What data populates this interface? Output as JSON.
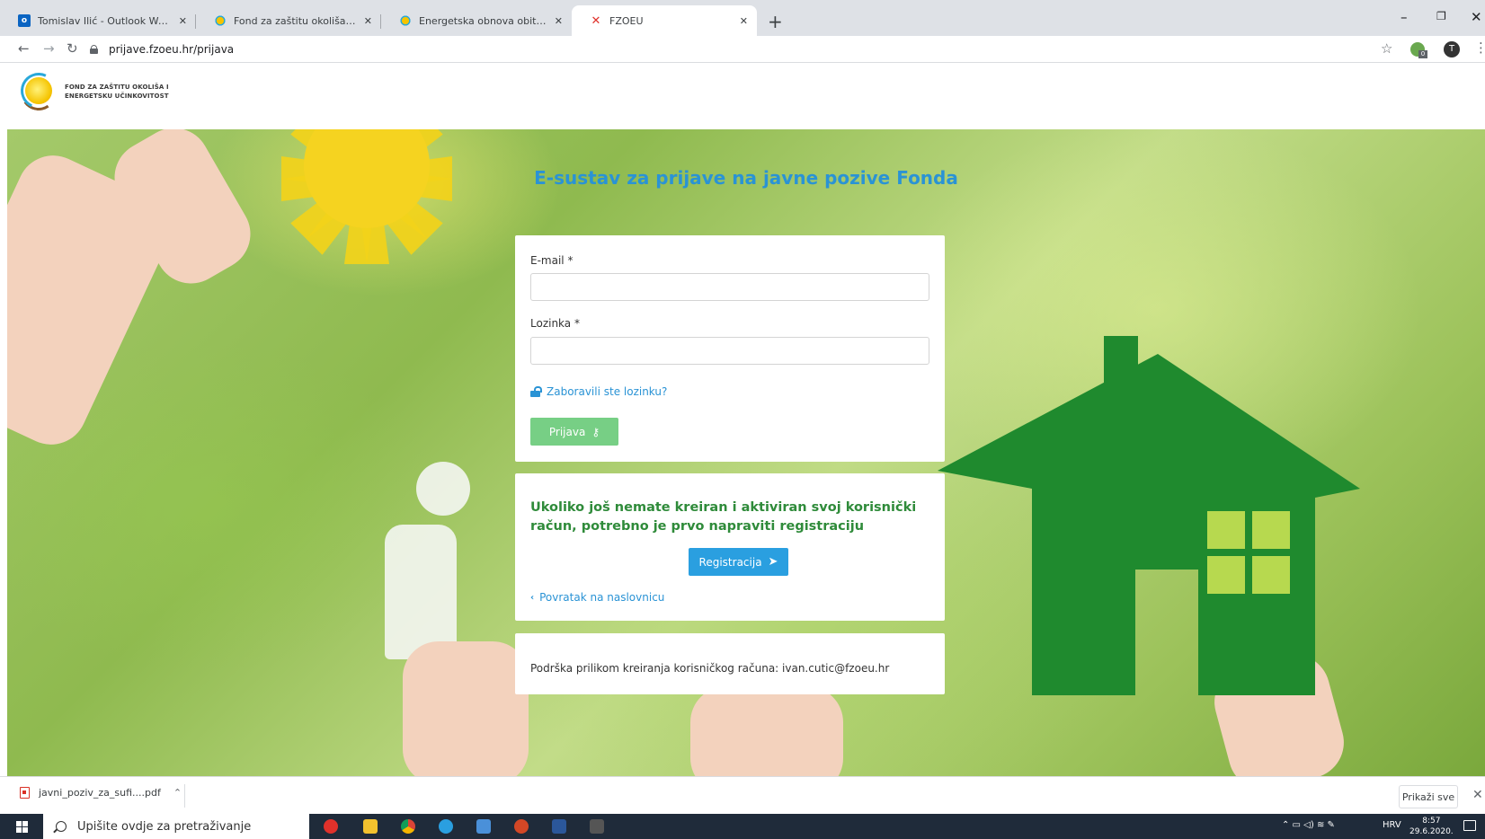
{
  "browser": {
    "tabs": [
      {
        "title": "Tomislav Ilić - Outlook Web App",
        "icon": "outlook-icon",
        "active": false
      },
      {
        "title": "Fond za zaštitu okoliša i energets",
        "icon": "fzoeu-icon",
        "active": false
      },
      {
        "title": "Energetska obnova obiteljskih ku",
        "icon": "fzoeu-icon",
        "active": false
      },
      {
        "title": "FZOEU",
        "icon": "fzoeu-red-icon",
        "active": true
      }
    ],
    "new_tab": "+",
    "url": "prijave.fzoeu.hr/prijava",
    "profile_initial": "T",
    "ext_badge": "0"
  },
  "site": {
    "logo_line1": "FOND ZA ZAŠTITU OKOLIŠA I",
    "logo_line2": "ENERGETSKU UČINKOVITOST"
  },
  "hero": {
    "title": "E-sustav za prijave na javne pozive Fonda"
  },
  "login": {
    "email_label": "E-mail *",
    "email_value": "",
    "password_label": "Lozinka *",
    "password_value": "",
    "forgot_link": "Zaboravili ste lozinku?",
    "login_button": "Prijava"
  },
  "registration": {
    "text": "Ukoliko još nemate kreiran i aktiviran svoj korisnički račun, potrebno je prvo napraviti registraciju",
    "register_button": "Registracija",
    "back_link": "Povratak na naslovnicu"
  },
  "support": {
    "text": "Podrška prilikom kreiranja korisničkog računa: ivan.cutic@fzoeu.hr"
  },
  "downloads": {
    "file": "javni_poziv_za_sufi....pdf",
    "show_all": "Prikaži sve"
  },
  "taskbar": {
    "search_placeholder": "Upišite ovdje za pretraživanje",
    "language": "HRV",
    "time": "8:57",
    "date": "29.6.2020."
  },
  "colors": {
    "accent_blue": "#2a93d5",
    "login_green": "#77cf85",
    "register_blue": "#2a9fe0",
    "heading_green": "#2f8b3a"
  }
}
